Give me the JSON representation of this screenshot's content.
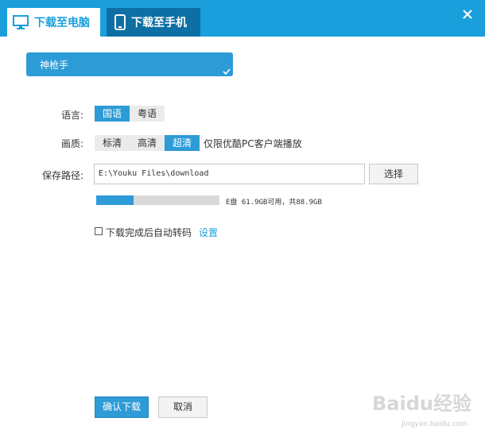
{
  "tabs": [
    {
      "label": "下载至电脑",
      "icon": "monitor-icon",
      "active": true
    },
    {
      "label": "下载至手机",
      "icon": "phone-icon",
      "active": false
    }
  ],
  "window": {
    "close_icon": "close-icon"
  },
  "video": {
    "title": "神枪手",
    "check_icon": "checkmark-icon"
  },
  "language": {
    "label": "语言:",
    "options": [
      {
        "label": "国语",
        "selected": true
      },
      {
        "label": "粤语",
        "selected": false
      }
    ]
  },
  "quality": {
    "label": "画质:",
    "options": [
      {
        "label": "标清",
        "selected": false
      },
      {
        "label": "高清",
        "selected": false
      },
      {
        "label": "超清",
        "selected": true
      }
    ],
    "note": "仅限优酷PC客户端播放"
  },
  "save_path": {
    "label": "保存路径:",
    "value": "E:\\Youku Files\\download",
    "browse_label": "选择"
  },
  "disk": {
    "info": "E盘 61.9GB可用，共88.9GB",
    "used_fraction": 0.3
  },
  "auto_convert": {
    "label": "下载完成后自动转码",
    "checked": false,
    "settings_link": "设置"
  },
  "actions": {
    "confirm_label": "确认下载",
    "cancel_label": "取消"
  },
  "watermark": {
    "text": "Baidu经验",
    "sub": "jingyan.baidu.com"
  },
  "colors": {
    "accent": "#1a9fdc",
    "tab_inactive": "#0d6fa3",
    "selected": "#2d9bd6"
  }
}
